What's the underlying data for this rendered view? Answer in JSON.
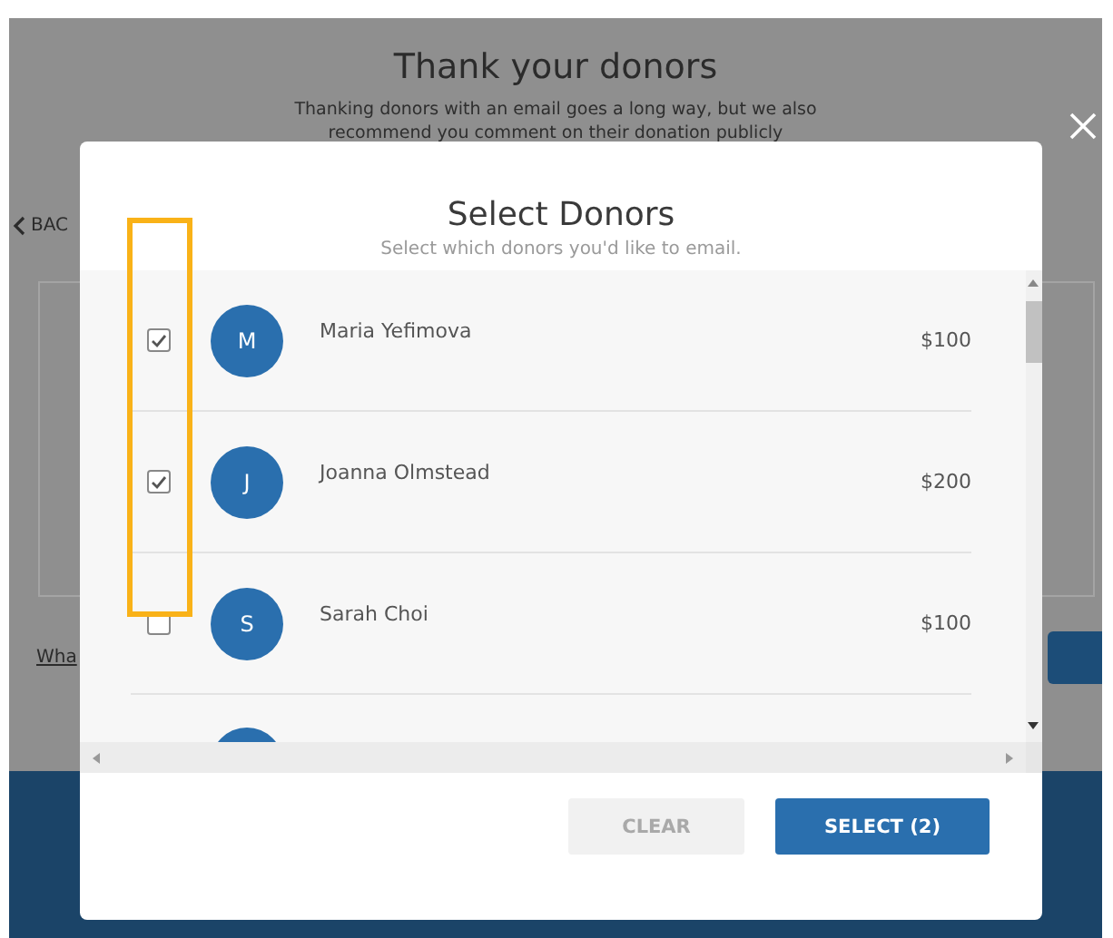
{
  "page": {
    "title": "Thank your donors",
    "description_lines": [
      "Thanking donors with an email goes a long way, but we also",
      "recommend you comment on their donation publicly"
    ],
    "back_link": "BAC",
    "help_link": "Wha"
  },
  "dialog": {
    "title": "Select Donors",
    "subtitle": "Select which donors you'd like to email.",
    "donors": [
      {
        "initial": "M",
        "name": "Maria Yefimova",
        "amount": "$100",
        "checked": true
      },
      {
        "initial": "J",
        "name": "Joanna Olmstead",
        "amount": "$200",
        "checked": true
      },
      {
        "initial": "S",
        "name": "Sarah Choi",
        "amount": "$100",
        "checked": false
      }
    ],
    "buttons": [
      {
        "kind": "secondary",
        "label": "CLEAR",
        "disabled": true
      },
      {
        "kind": "primary",
        "label": "SELECT (2)",
        "disabled": false
      }
    ]
  }
}
